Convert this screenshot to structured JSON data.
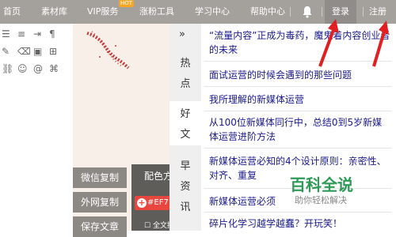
{
  "nav": {
    "items": [
      "首页",
      "素材库",
      "VIP服务",
      "涨粉工具",
      "学习中心",
      "帮助中心"
    ],
    "hot_badge": "HOT",
    "login": "登录",
    "register": "注册"
  },
  "panel": {
    "arrow": "»",
    "tabs": [
      "热点",
      "好文",
      "早资讯"
    ],
    "active_tab": "好文"
  },
  "articles": [
    "“流量内容”正成为毒药，魔鬼着内容创业者的未来",
    "面试运营的时候会遇到的那些问题",
    "我所理解的新媒体运营",
    "从100位新媒体同行中，总结0到5岁新媒体运营进阶方法",
    "新媒体运营必知的4个设计原则：亲密性、对齐、重复",
    "新媒体运营必须",
    "碎片化学习越学越蠢？开玩笑！"
  ],
  "buttons": {
    "wechat_copy": "微信复制",
    "external_copy": "外网复制",
    "save_article": "保存文章"
  },
  "color": {
    "title": "配色方案",
    "chip_label": "#EF7",
    "chip_color": "#e8463f",
    "check_label": "全文换色"
  },
  "watermark": {
    "title": "百科全说",
    "subtitle": "助你轻松解决"
  },
  "colors": {
    "topbar": "#a4a09c",
    "link": "#1a1a8f",
    "arrow": "#e02020"
  }
}
